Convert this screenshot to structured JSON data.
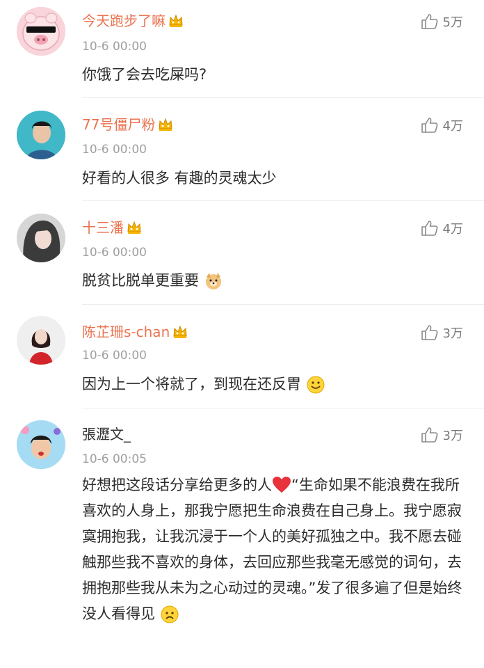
{
  "comments": [
    {
      "username": "今天跑步了嘛",
      "time": "10-6 00:00",
      "likes": "5万",
      "text": "你饿了会去吃屎吗?",
      "vip": true
    },
    {
      "username": "77号僵尸粉",
      "time": "10-6 00:00",
      "likes": "4万",
      "text": "好看的人很多 有趣的灵魂太少",
      "vip": true
    },
    {
      "username": "十三潘",
      "time": "10-6 00:00",
      "likes": "4万",
      "text": "脱贫比脱单更重要",
      "vip": true,
      "emoji": "doge-emoji"
    },
    {
      "username": "陈芷珊s-chan",
      "time": "10-6 00:00",
      "likes": "3万",
      "text": "因为上一个将就了，到现在还反胃",
      "vip": true,
      "emoji": "smile-emoji"
    },
    {
      "username": "張瀝文_",
      "time": "10-6 00:05",
      "likes": "3万",
      "text_before_heart": "好想把这段话分享给更多的人",
      "text_after_heart": "“生命如果不能浪费在我所喜欢的人身上，那我宁愿把生命浪费在自己身上。我宁愿寂寞拥抱我，让我沉浸于一个人的美好孤独之中。我不愿去碰触那些我不喜欢的身体，去回应那些我毫无感觉的词句，去拥抱那些我从未为之心动过的灵魂。”发了很多遍了但是始终没人看得见",
      "vip": false,
      "emojis": [
        "heart-emoji",
        "sad-emoji"
      ]
    }
  ],
  "colors": {
    "username": "#eb7350",
    "time": "#a0a0a0",
    "text": "#2c2c2c",
    "vip_crown": "#f5b400"
  }
}
